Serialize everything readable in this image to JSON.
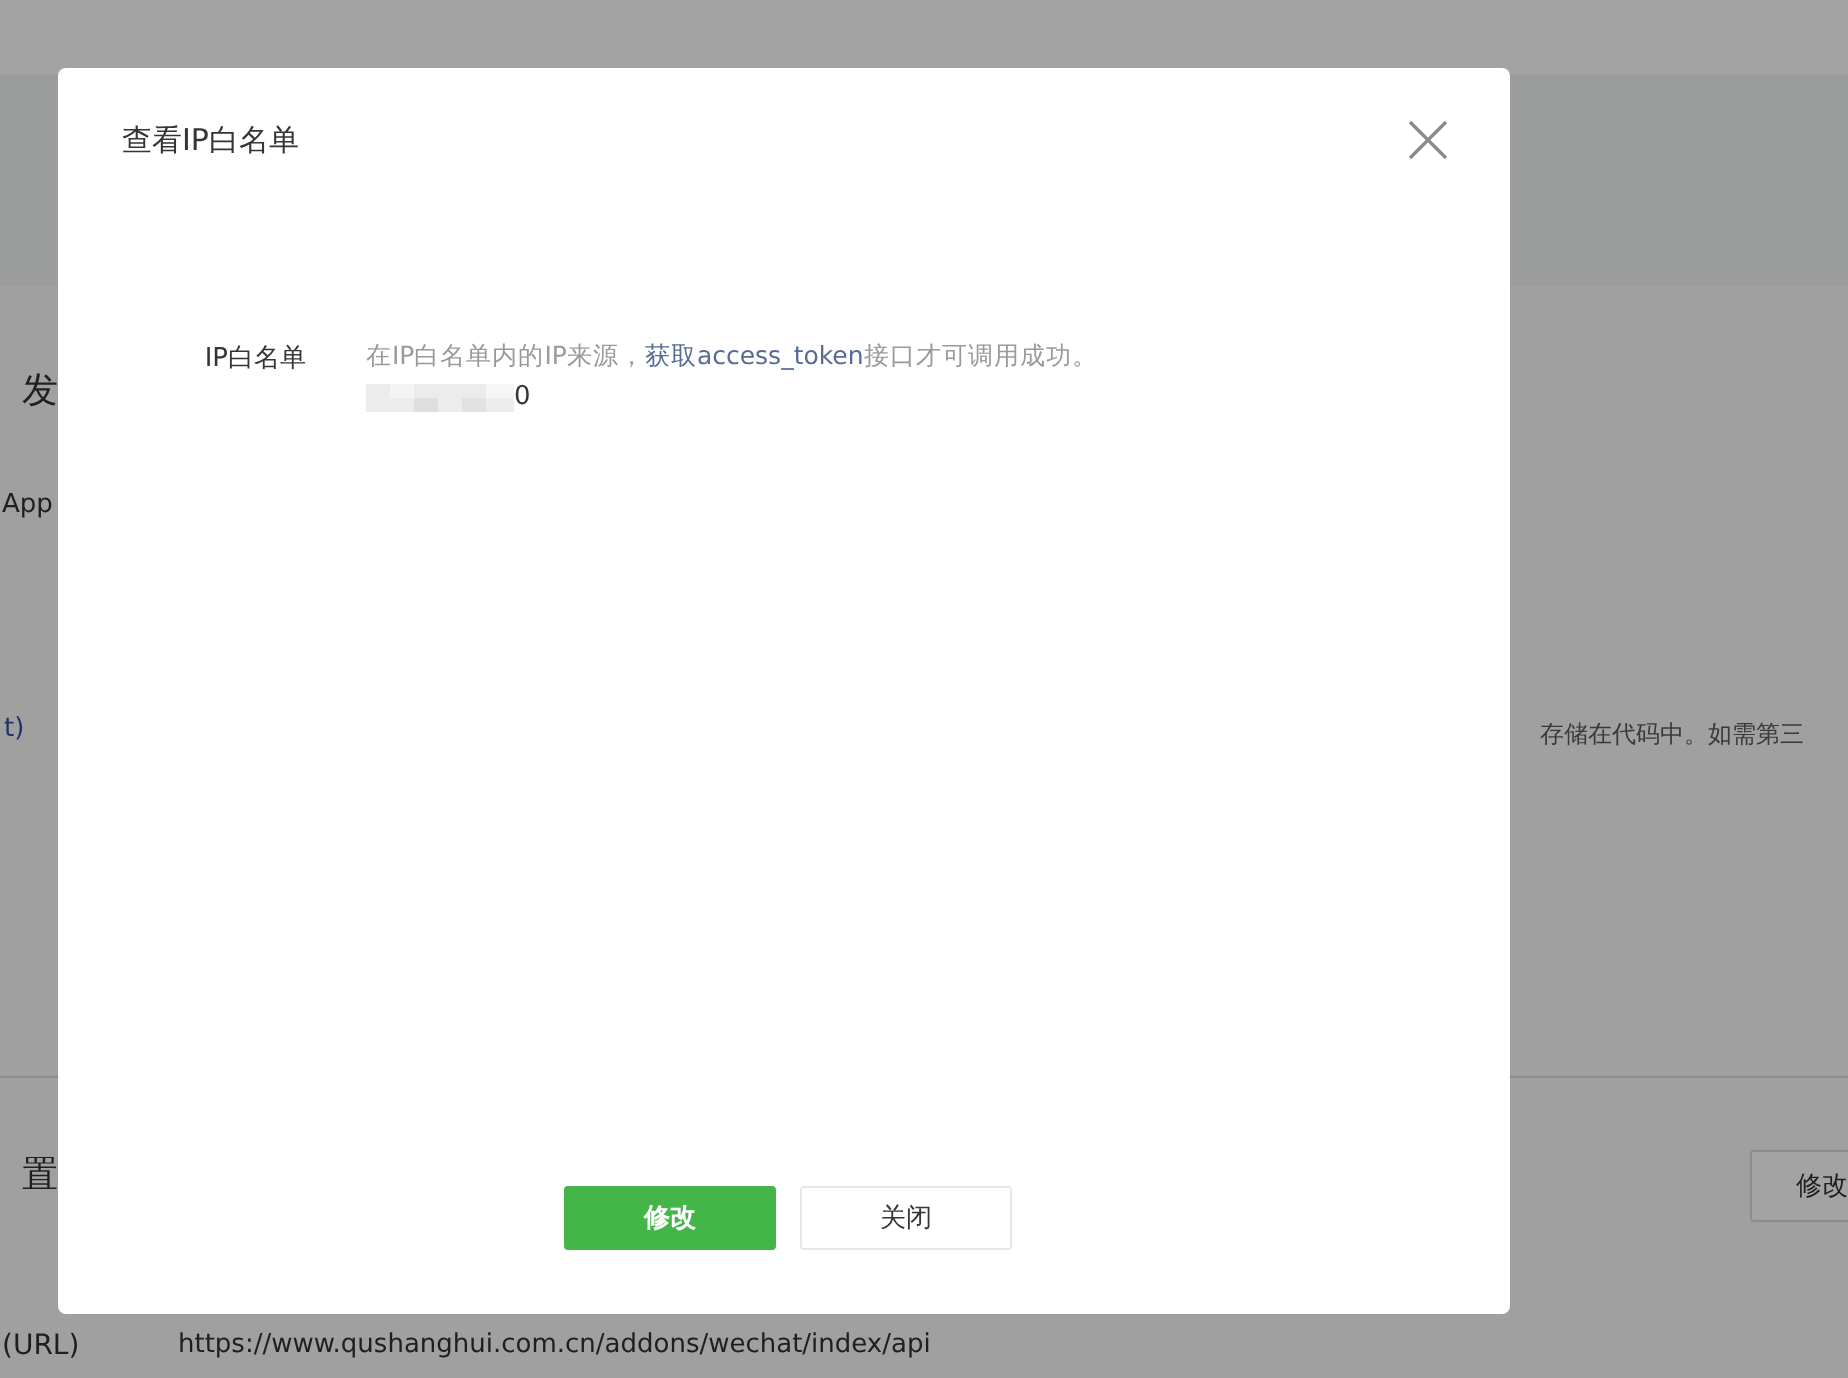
{
  "page": {
    "section_heading_1": "发",
    "appid_label": "App",
    "secret_label_2": "t)",
    "secret_hint": "存储在代码中。如需第三",
    "section_heading_2": "置",
    "edit_button": "修改",
    "url_label": "(URL)",
    "url_value": "https://www.qushanghui.com.cn/addons/wechat/index/api"
  },
  "dialog": {
    "title": "查看IP白名单",
    "field_label": "IP白名单",
    "description": {
      "before": "在IP白名单内的IP来源，",
      "link": "获取access_token",
      "after": "接口才可调用成功。"
    },
    "ip_value": {
      "redacted": true,
      "visible": "0"
    },
    "buttons": [
      {
        "label": "修改",
        "kind": "primary"
      },
      {
        "label": "关闭",
        "kind": "default"
      }
    ]
  }
}
